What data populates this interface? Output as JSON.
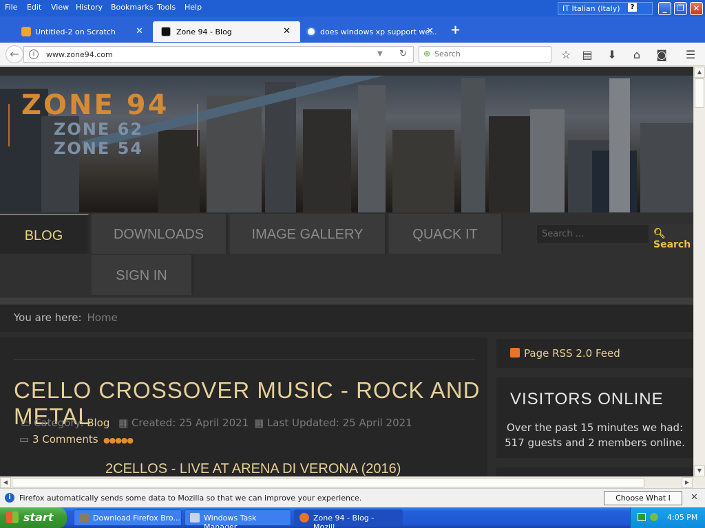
{
  "menu": [
    "File",
    "Edit",
    "View",
    "History",
    "Bookmarks",
    "Tools",
    "Help"
  ],
  "language": "IT  Italian (Italy)",
  "tabs": [
    {
      "title": "Untitled-2 on Scratch"
    },
    {
      "title": "Zone 94 - Blog"
    },
    {
      "title": "does windows xp support we..."
    }
  ],
  "url": "www.zone94.com",
  "search_placeholder": "Search",
  "site": {
    "logo": [
      "ZONE 94",
      "ZONE 62",
      "ZONE 54"
    ],
    "nav": [
      "BLOG",
      "DOWNLOADS",
      "IMAGE GALLERY",
      "QUACK IT",
      "SIGN IN"
    ],
    "search_placeholder": "Search ...",
    "search_button": "Search",
    "breadcrumb_label": "You are here:",
    "breadcrumb_home": "Home",
    "article": {
      "title": "CELLO CROSSOVER MUSIC - ROCK AND METAL",
      "category_label": "Category:",
      "category": "Blog",
      "created": "Created: 25 April 2021",
      "updated": "Last Updated: 25 April 2021",
      "comments": "3 Comments",
      "subtitle": "2CELLOS - LIVE AT ARENA DI VERONA (2016)"
    },
    "sidebar": {
      "rss": "Page RSS 2.0 Feed",
      "visitors_heading": "VISITORS ONLINE",
      "visitors_line1": "Over the past 15 minutes we had:",
      "visitors_line2": "517 guests and 2 members online."
    }
  },
  "notification": {
    "message": "Firefox automatically sends some data to Mozilla so that we can improve your experience.",
    "button": "Choose What I Share"
  },
  "taskbar": {
    "start": "start",
    "tasks": [
      "Download Firefox Bro...",
      "Windows Task Manager",
      "Zone 94 - Blog - Mozill..."
    ],
    "clock": "4:05 PM"
  }
}
